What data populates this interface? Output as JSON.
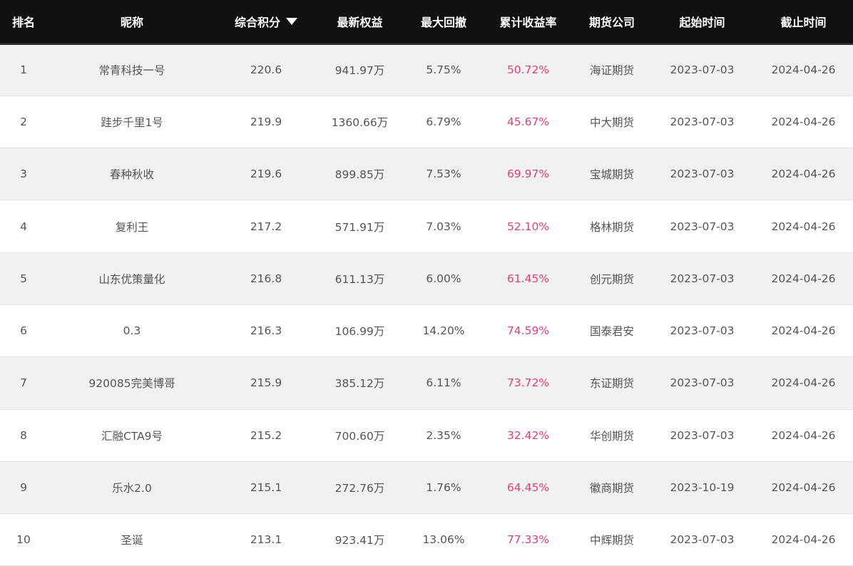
{
  "header": {
    "rank": "排名",
    "nickname": "昵称",
    "score": "综合积分",
    "equity": "最新权益",
    "drawdown": "最大回撤",
    "return_rate": "累计收益率",
    "company": "期货公司",
    "start": "起始时间",
    "end": "截止时间"
  },
  "sort_icon": "sort-descending-triangle",
  "colors": {
    "header_bg": "#111111",
    "rate": "#e0407a",
    "stripe": "#f1f1f1"
  },
  "rows": [
    {
      "rank": "1",
      "nickname": "常青科技一号",
      "score": "220.6",
      "equity": "941.97万",
      "drawdown": "5.75%",
      "rate": "50.72%",
      "company": "海证期货",
      "start": "2023-07-03",
      "end": "2024-04-26"
    },
    {
      "rank": "2",
      "nickname": "跬步千里1号",
      "score": "219.9",
      "equity": "1360.66万",
      "drawdown": "6.79%",
      "rate": "45.67%",
      "company": "中大期货",
      "start": "2023-07-03",
      "end": "2024-04-26"
    },
    {
      "rank": "3",
      "nickname": "春种秋收",
      "score": "219.6",
      "equity": "899.85万",
      "drawdown": "7.53%",
      "rate": "69.97%",
      "company": "宝城期货",
      "start": "2023-07-03",
      "end": "2024-04-26"
    },
    {
      "rank": "4",
      "nickname": "复利王",
      "score": "217.2",
      "equity": "571.91万",
      "drawdown": "7.03%",
      "rate": "52.10%",
      "company": "格林期货",
      "start": "2023-07-03",
      "end": "2024-04-26"
    },
    {
      "rank": "5",
      "nickname": "山东优策量化",
      "score": "216.8",
      "equity": "611.13万",
      "drawdown": "6.00%",
      "rate": "61.45%",
      "company": "创元期货",
      "start": "2023-07-03",
      "end": "2024-04-26"
    },
    {
      "rank": "6",
      "nickname": "0.3",
      "score": "216.3",
      "equity": "106.99万",
      "drawdown": "14.20%",
      "rate": "74.59%",
      "company": "国泰君安",
      "start": "2023-07-03",
      "end": "2024-04-26"
    },
    {
      "rank": "7",
      "nickname": "920085完美博哥",
      "score": "215.9",
      "equity": "385.12万",
      "drawdown": "6.11%",
      "rate": "73.72%",
      "company": "东证期货",
      "start": "2023-07-03",
      "end": "2024-04-26"
    },
    {
      "rank": "8",
      "nickname": "汇融CTA9号",
      "score": "215.2",
      "equity": "700.60万",
      "drawdown": "2.35%",
      "rate": "32.42%",
      "company": "华创期货",
      "start": "2023-07-03",
      "end": "2024-04-26"
    },
    {
      "rank": "9",
      "nickname": "乐水2.0",
      "score": "215.1",
      "equity": "272.76万",
      "drawdown": "1.76%",
      "rate": "64.45%",
      "company": "徽商期货",
      "start": "2023-10-19",
      "end": "2024-04-26"
    },
    {
      "rank": "10",
      "nickname": "圣诞",
      "score": "213.1",
      "equity": "923.41万",
      "drawdown": "13.06%",
      "rate": "77.33%",
      "company": "中辉期货",
      "start": "2023-07-03",
      "end": "2024-04-26"
    }
  ]
}
